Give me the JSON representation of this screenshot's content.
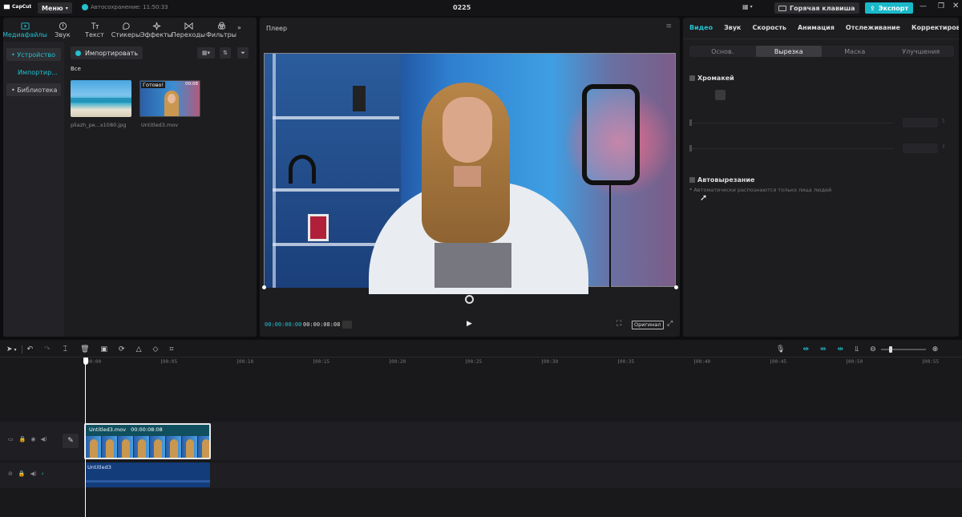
{
  "app": {
    "logo": "CapCut",
    "menu_label": "Меню",
    "autosave": "Автосохранение: 11:50:33",
    "project_title": "0225",
    "hotkey_label": "Горячая клавиша",
    "export_label": "Экспорт"
  },
  "media_tabs": [
    {
      "label": "Медиафайлы",
      "icon": "media-icon",
      "active": true
    },
    {
      "label": "Звук",
      "icon": "audio-icon"
    },
    {
      "label": "Текст",
      "icon": "text-icon"
    },
    {
      "label": "Стикеры",
      "icon": "sticker-icon"
    },
    {
      "label": "Эффекты",
      "icon": "effects-icon"
    },
    {
      "label": "Переходы",
      "icon": "transitions-icon"
    },
    {
      "label": "Фильтры",
      "icon": "filters-icon"
    }
  ],
  "sidebar": {
    "items": [
      {
        "label": "• Устройство",
        "active": true
      },
      {
        "label": "Импортир...",
        "active": false
      },
      {
        "label": "• Библиотека",
        "active": false
      }
    ]
  },
  "media": {
    "import_label": "Импортировать",
    "filter_all": "Все",
    "files": [
      {
        "name": "pliazh_pe...x1080.jpg"
      },
      {
        "name": "Untitled3.mov",
        "badge": "Готово!",
        "duration": "00:08"
      }
    ]
  },
  "player": {
    "title": "Плеер",
    "current_time": "00:00:00:00",
    "total_time": "00:00:08:08",
    "ratio_label": "Оригинал"
  },
  "props": {
    "tabs": [
      "Видео",
      "Звук",
      "Скорость",
      "Анимация",
      "Отслеживание",
      "Корректировка"
    ],
    "active_tab": "Видео",
    "subtabs": [
      "Основ.",
      "Вырезка",
      "Маска",
      "Улучшения"
    ],
    "active_subtab": "Вырезка",
    "chroma_label": "Хромакей",
    "auto_cut_label": "Автовырезание",
    "auto_cut_hint": "* Автоматически распознаются только лица людей"
  },
  "timeline": {
    "ticks": [
      "00:00",
      "00:05",
      "00:10",
      "00:15",
      "00:20",
      "00:25",
      "00:30",
      "00:35",
      "00:40",
      "00:45",
      "00:50",
      "00:55"
    ],
    "video_clip": {
      "name": "Untitled3.mov",
      "duration": "00:00:08:08"
    },
    "audio_clip": {
      "name": "Untitled3"
    }
  },
  "colors": {
    "accent": "#23c0cf",
    "export_bg": "#19b9c9",
    "clip_bg": "#0f4f5e",
    "audio_clip_bg": "#123c7a"
  }
}
